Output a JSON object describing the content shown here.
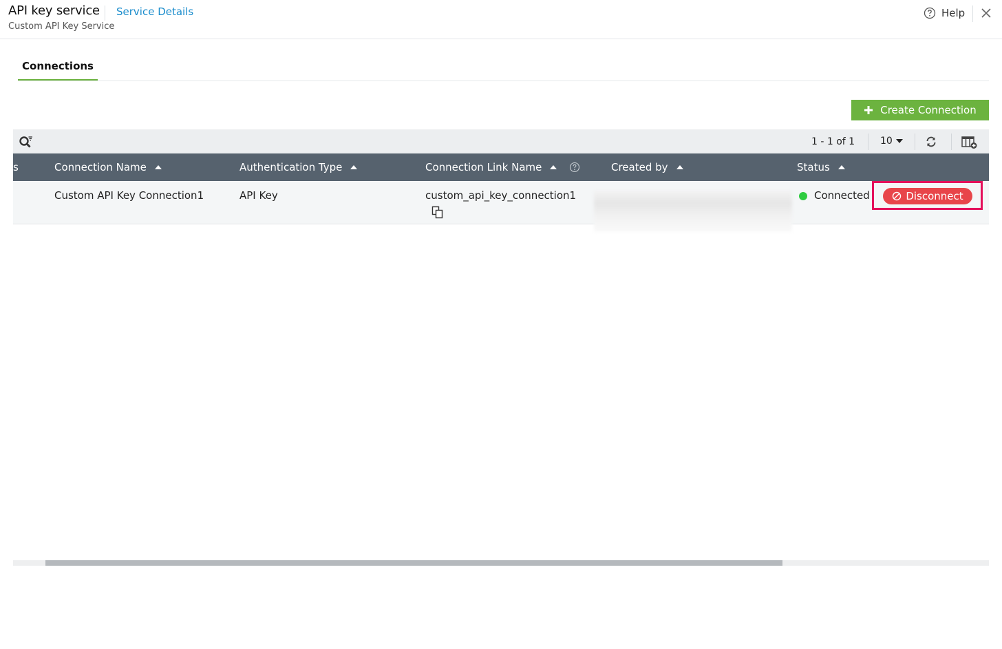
{
  "header": {
    "title": "API key service",
    "service_details_link": "Service Details",
    "subtitle": "Custom API Key Service",
    "help_label": "Help",
    "icons": {
      "help": "help-circle-icon",
      "close": "close-icon"
    }
  },
  "tabs": [
    {
      "label": "Connections",
      "active": true
    }
  ],
  "actions": {
    "create_connection_label": "Create Connection",
    "create_icon": "plus-icon"
  },
  "toolbar": {
    "pagination": "1 - 1 of 1",
    "page_size": "10",
    "icons": {
      "search": "search-filter-icon",
      "refresh": "refresh-icon",
      "columns": "columns-settings-icon"
    }
  },
  "table": {
    "truncated_left_header": "s",
    "columns": [
      {
        "label": "Connection Name",
        "sortable": true
      },
      {
        "label": "Authentication Type",
        "sortable": true
      },
      {
        "label": "Connection Link Name",
        "sortable": true,
        "has_help": true
      },
      {
        "label": "Created by",
        "sortable": true
      },
      {
        "label": "Status",
        "sortable": true
      }
    ],
    "rows": [
      {
        "connection_name": "Custom API Key Connection1",
        "authentication_type": "API Key",
        "connection_link_name": "custom_api_key_connection1",
        "created_by": "",
        "status": "Connected",
        "action_label": "Disconnect"
      }
    ]
  },
  "colors": {
    "accent_green": "#6cb33f",
    "link_blue": "#1a8ccc",
    "header_bg": "#56626e",
    "status_connected": "#2ecc40",
    "disconnect_red": "#e8454a",
    "highlight": "#e4105b"
  }
}
